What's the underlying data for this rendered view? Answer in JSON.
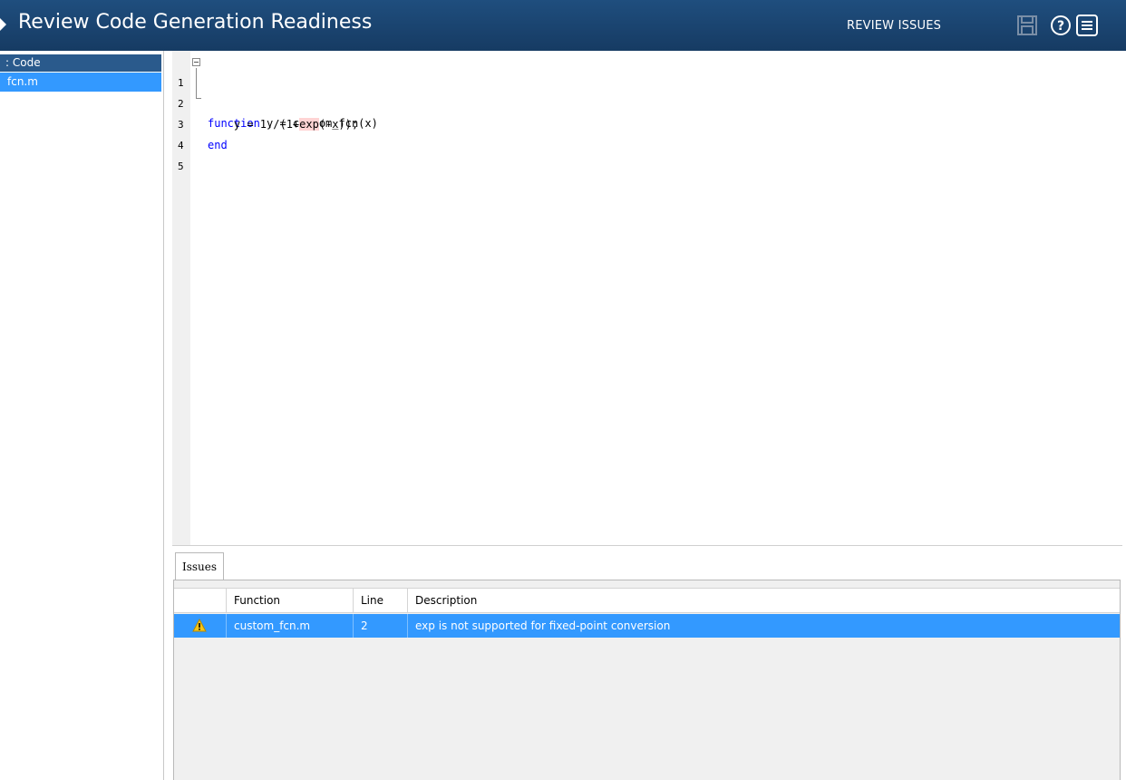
{
  "header": {
    "title": "Review Code Generation Readiness",
    "review_issues_label": "REVIEW ISSUES",
    "icons": [
      "save-icon",
      "help-icon",
      "menu-icon"
    ]
  },
  "tree": {
    "root_label": ": Code",
    "file_label": "fcn.m"
  },
  "editor": {
    "line_numbers": [
      "1",
      "2",
      "3",
      "4",
      "5"
    ],
    "lines": [
      {
        "keyword": "function",
        "rest": " y = custom_fcn(x)"
      },
      {
        "prefix": "    y = 1./(1+",
        "highlight": "exp",
        "suffix": "(-x));"
      },
      {
        "keyword": "end"
      }
    ]
  },
  "issues": {
    "tab_label": "Issues",
    "columns": [
      "Function",
      "Line",
      "Description"
    ],
    "rows": [
      {
        "icon": "warning-icon",
        "function": "custom_fcn.m",
        "line": "2",
        "description": "exp is not supported for fixed-point conversion"
      }
    ]
  },
  "colors": {
    "header_bg": "#1f4e7e",
    "selection": "#3399ff",
    "keyword": "#0000ff",
    "issue_highlight": "#ffd4d4",
    "warning": "#f5c518"
  }
}
